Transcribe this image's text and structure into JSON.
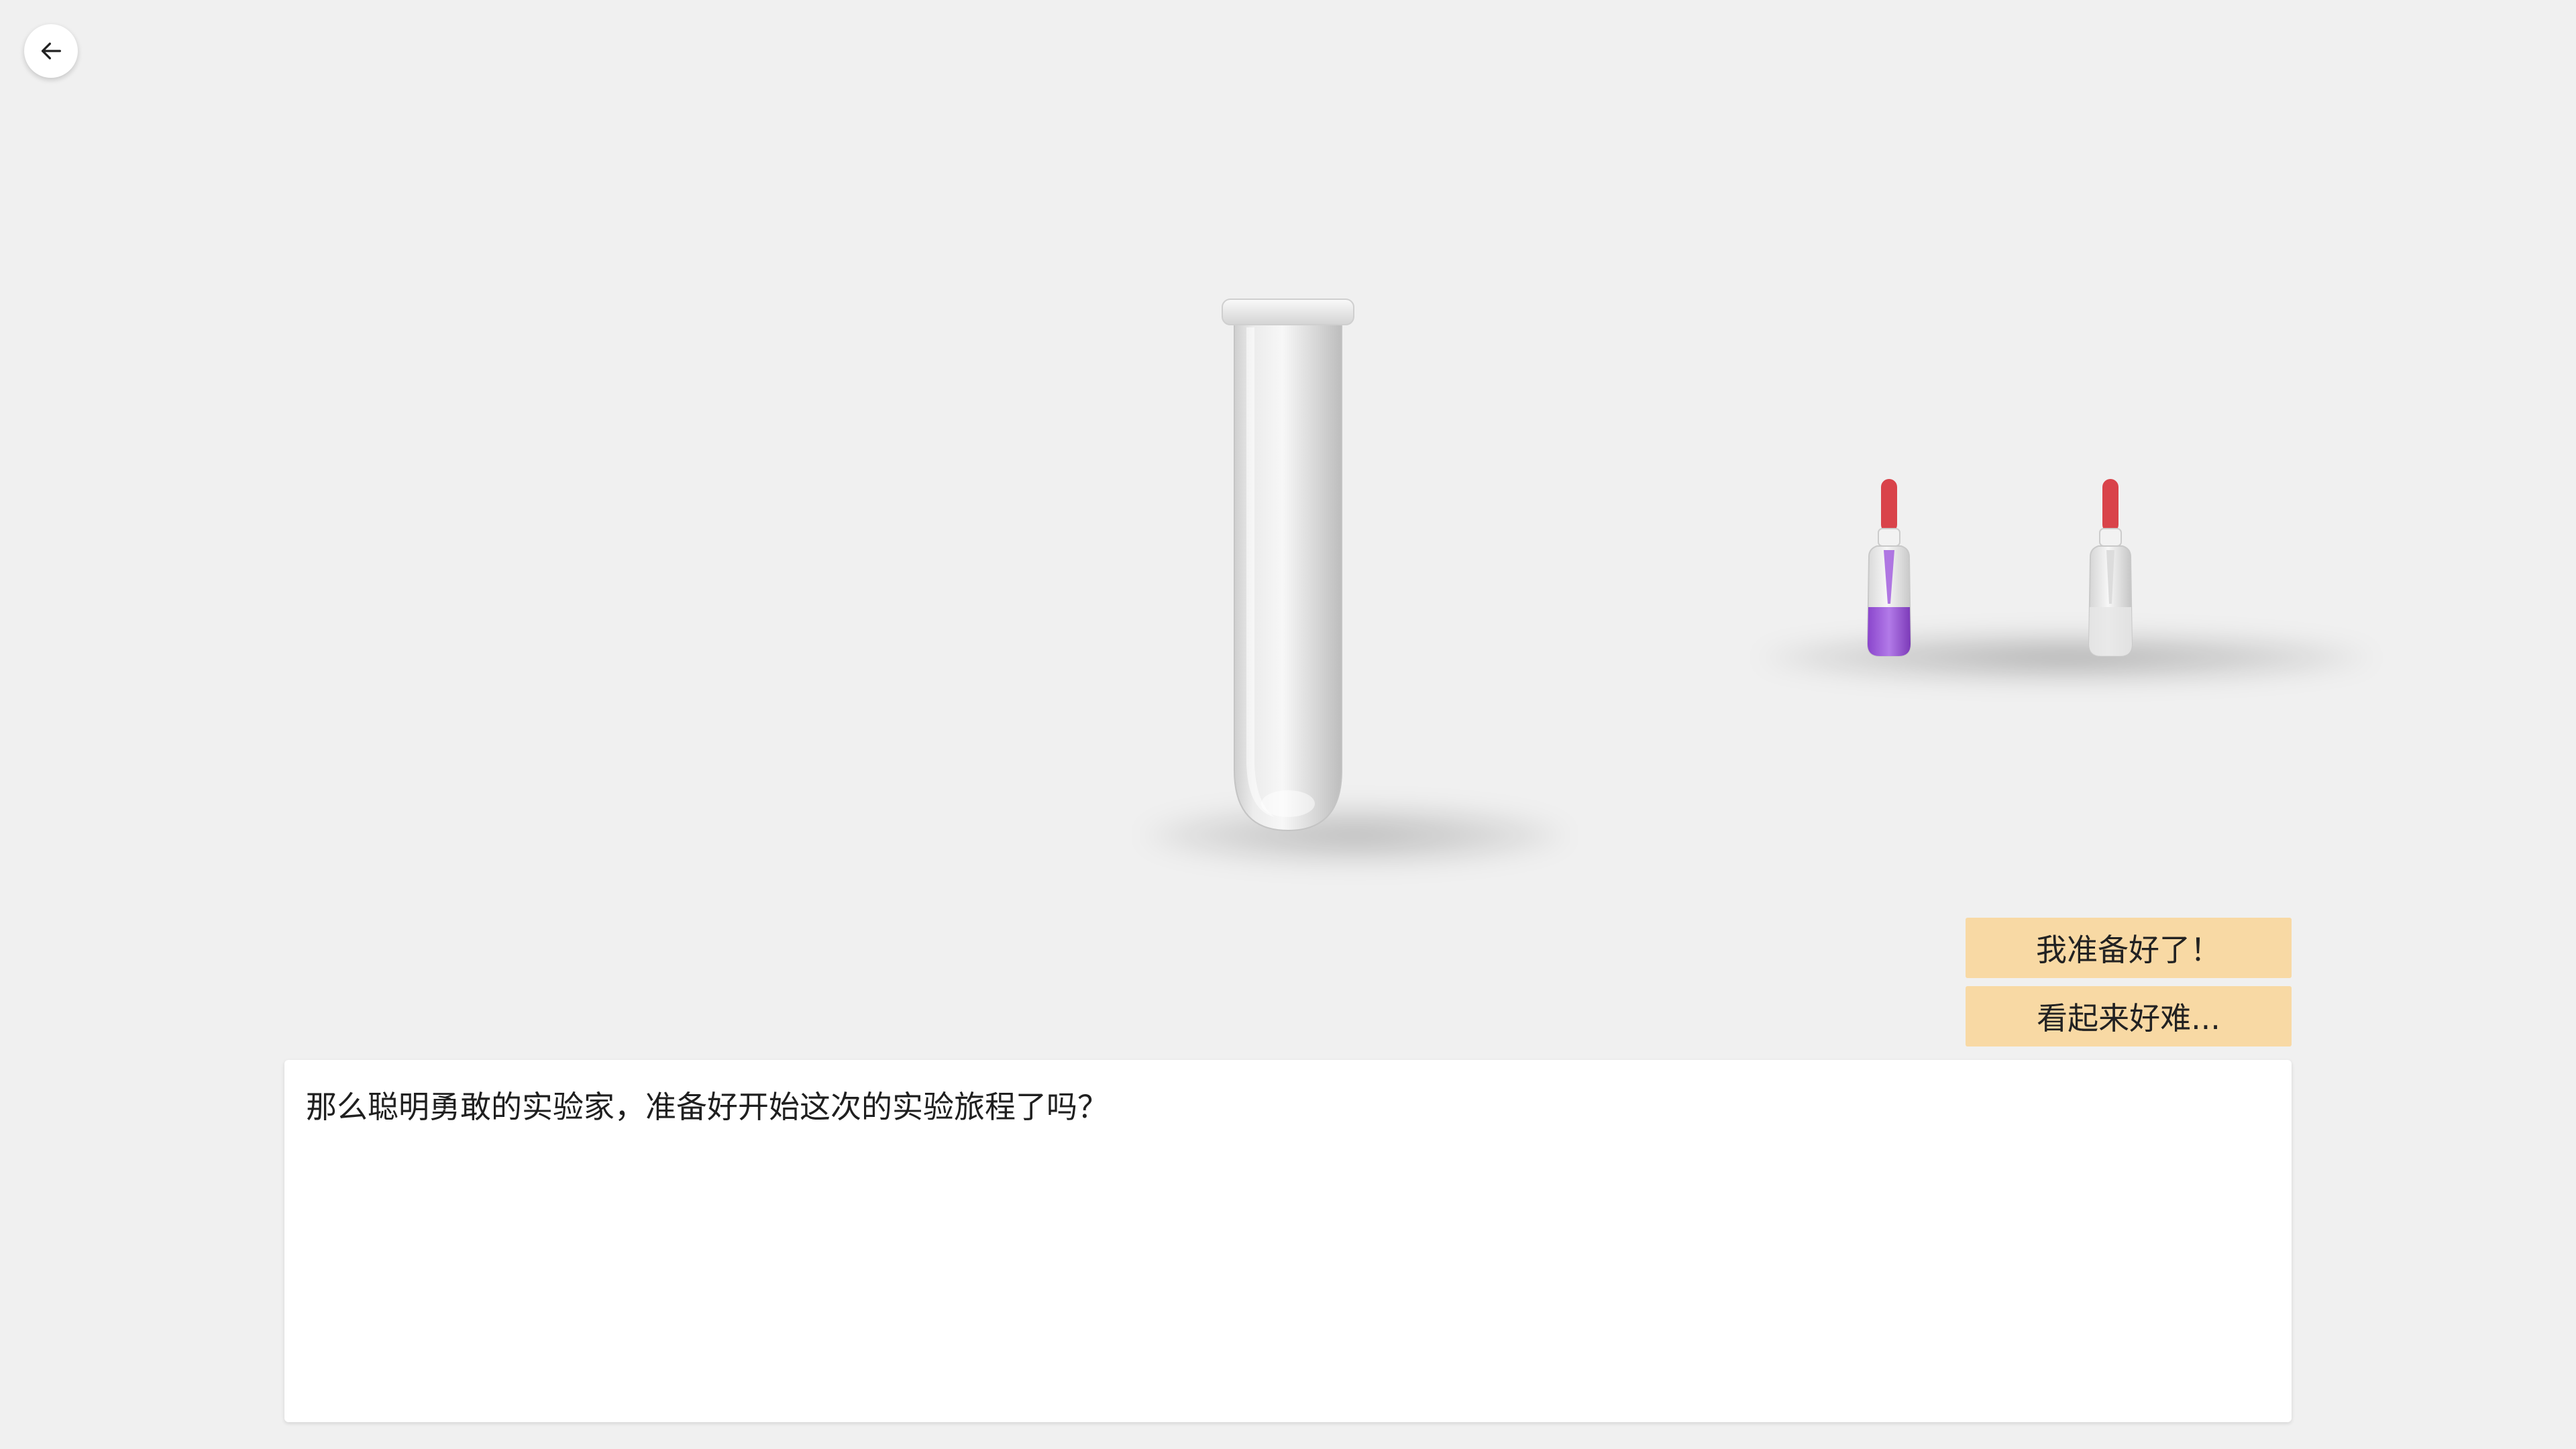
{
  "navigation": {
    "back_icon": "arrow-left-icon"
  },
  "scene": {
    "items": [
      {
        "name": "test-tube",
        "liquid_color": "none"
      },
      {
        "name": "dropper-bottle-purple",
        "liquid_color": "#9b5bd6",
        "cap_color": "#d9434a"
      },
      {
        "name": "dropper-bottle-clear",
        "liquid_color": "#e6e6e6",
        "cap_color": "#d9434a"
      }
    ]
  },
  "choices": [
    {
      "label": "我准备好了！"
    },
    {
      "label": "看起来好难..."
    }
  ],
  "dialog": {
    "text": "那么聪明勇敢的实验家，准备好开始这次的实验旅程了吗？"
  },
  "colors": {
    "background": "#f0f0f0",
    "choice_bg": "#f8d9a4",
    "dialog_bg": "#ffffff"
  }
}
